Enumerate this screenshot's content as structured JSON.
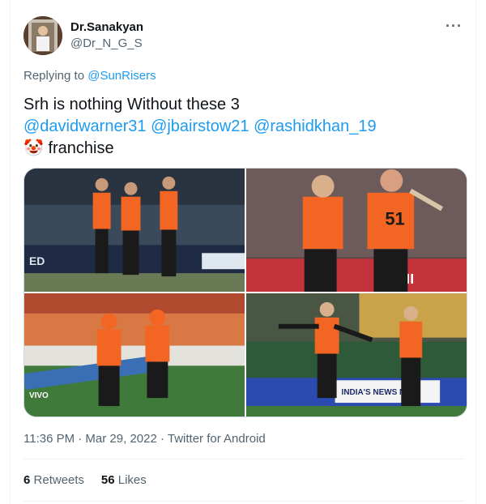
{
  "author": {
    "display_name": "Dr.Sanakyan",
    "handle": "@Dr_N_G_S"
  },
  "menu_icon": "ellipsis-icon",
  "reply": {
    "prefix": "Replying to",
    "to": "@SunRisers"
  },
  "tweet": {
    "line1": "Srh is nothing Without these 3",
    "mentions": [
      "@davidwarner31",
      "@jbairstow21",
      "@rashidkhan_19"
    ],
    "emoji": "🤡",
    "line3": "franchise"
  },
  "photos": [
    {
      "alt": "three players on field",
      "board_text": "ED"
    },
    {
      "alt": "two players celebrating",
      "board_text": "AMI",
      "jersey_number": "51"
    },
    {
      "alt": "two players running off field",
      "board_text": "VIVO"
    },
    {
      "alt": "two players celebrating on field",
      "board_text": "INDIA'S NEWS NET"
    }
  ],
  "timestamp": "11:36 PM · Mar 29, 2022 · Twitter for Android",
  "stats": {
    "retweets_count": "6",
    "retweets_label": "Retweets",
    "likes_count": "56",
    "likes_label": "Likes"
  },
  "colors": {
    "link": "#1d9bf0",
    "srh_orange": "#f26522",
    "muted": "#536471"
  }
}
